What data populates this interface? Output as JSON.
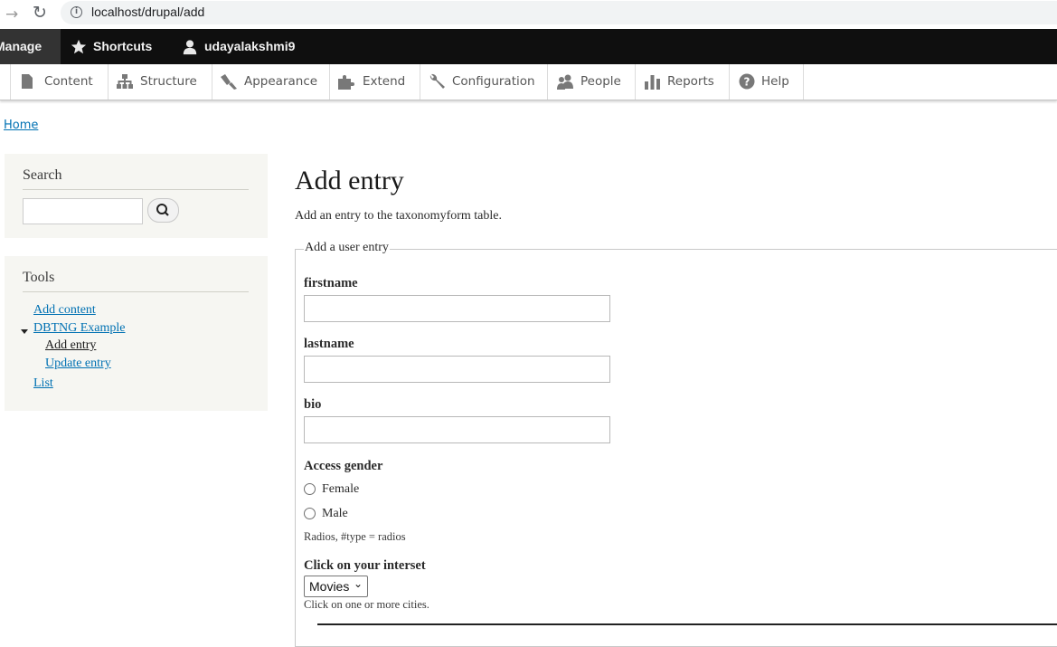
{
  "browser": {
    "url": "localhost/drupal/add"
  },
  "toolbar": {
    "manage": "Manage",
    "shortcuts": "Shortcuts",
    "user": "udayalakshmi9"
  },
  "tray": {
    "items": [
      {
        "label": "Content",
        "icon": "file-icon"
      },
      {
        "label": "Structure",
        "icon": "sitemap-icon"
      },
      {
        "label": "Appearance",
        "icon": "paintbrush-icon"
      },
      {
        "label": "Extend",
        "icon": "puzzle-icon"
      },
      {
        "label": "Configuration",
        "icon": "wrench-icon"
      },
      {
        "label": "People",
        "icon": "people-icon"
      },
      {
        "label": "Reports",
        "icon": "bar-chart-icon"
      },
      {
        "label": "Help",
        "icon": "help-icon"
      }
    ]
  },
  "breadcrumb": "Home",
  "sidebar": {
    "search_title": "Search",
    "tools_title": "Tools",
    "links": {
      "add_content": "Add content",
      "dbtng_example": "DBTNG Example",
      "add_entry": "Add entry",
      "update_entry": "Update entry",
      "list": "List"
    }
  },
  "main": {
    "title": "Add entry",
    "description": "Add an entry to the taxonomyform table.",
    "fieldset_legend": "Add a user entry",
    "fields": {
      "firstname": "firstname",
      "lastname": "lastname",
      "bio": "bio"
    },
    "gender": {
      "label": "Access gender",
      "options": [
        "Female",
        "Male"
      ],
      "description": "Radios, #type = radios"
    },
    "interest": {
      "label": "Click on your interset",
      "selected": "Movies",
      "description": "Click on one or more cities."
    }
  },
  "colors": {
    "link": "#0071b3",
    "toolbar_bg": "#0f0f0f",
    "sidebar_bg": "#f6f6f2"
  }
}
